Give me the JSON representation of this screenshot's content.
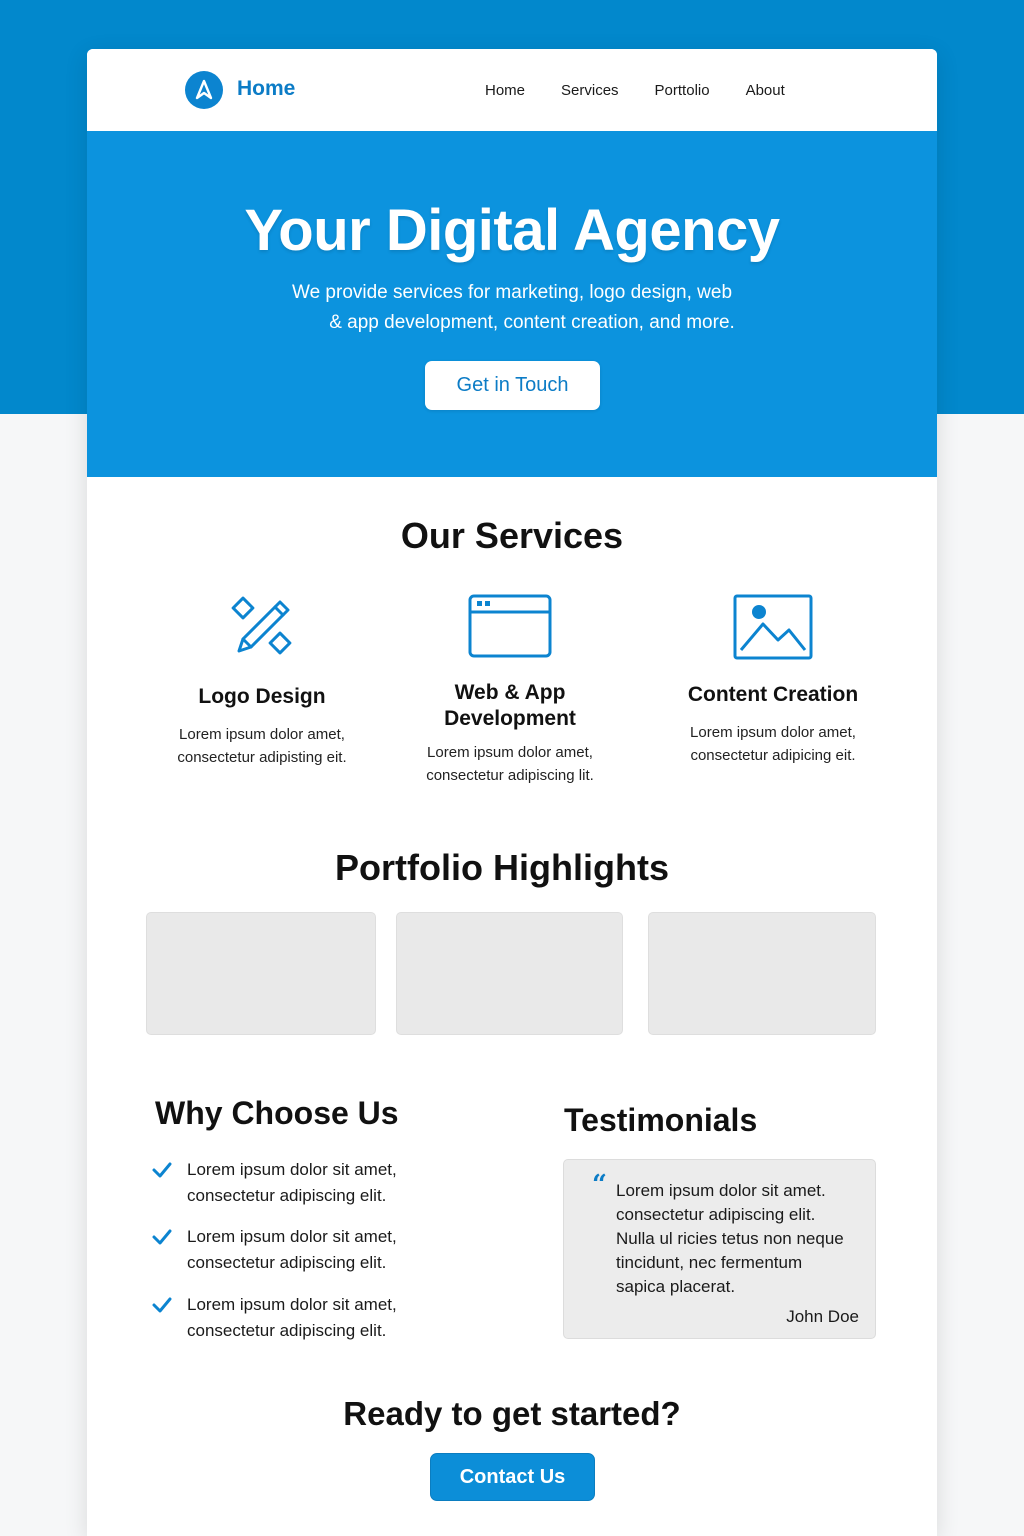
{
  "nav": {
    "brand": "Home",
    "links": [
      "Home",
      "Services",
      "Porttolio",
      "About"
    ]
  },
  "hero": {
    "title": "Your Digital Agency",
    "subtitle_line1": "We provide services for marketing, logo design, web",
    "subtitle_line2": "& app development, content creation, and more.",
    "button": "Get in Touch"
  },
  "services": {
    "title": "Our Services",
    "items": [
      {
        "icon": "pencil-ruler-icon",
        "title": "Logo Design",
        "desc_line1": "Lorem ipsum dolor amet,",
        "desc_line2": "consectetur adipisting eit."
      },
      {
        "icon": "browser-window-icon",
        "title_line1": "Web & App",
        "title_line2": "Development",
        "desc_line1": "Lorem ipsum dolor amet,",
        "desc_line2": "consectetur adipiscing lit."
      },
      {
        "icon": "image-icon",
        "title": "Content Creation",
        "desc_line1": "Lorem ipsum dolor amet,",
        "desc_line2": "consectetur adipicing eit."
      }
    ]
  },
  "portfolio": {
    "title": "Portfolio Highlights"
  },
  "why": {
    "title": "Why Choose Us",
    "items": [
      {
        "line1": "Lorem ipsum dolor sit amet,",
        "line2": "consectetur adipiscing elit."
      },
      {
        "line1": "Lorem ipsum dolor sit amet,",
        "line2": "consectetur adipiscing elit."
      },
      {
        "line1": "Lorem ipsum dolor sit amet,",
        "line2": "consectetur adipiscing elit."
      }
    ]
  },
  "testimonials": {
    "title": "Testimonials",
    "quote_mark": "“",
    "lines": [
      "Lorem ipsum dolor sit amet.",
      "consectetur adipiscing elit.",
      "Nulla ul ricies tetus non neque",
      "tincidunt, nec fermentum",
      "sapica placerat."
    ],
    "author": "John Doe"
  },
  "cta": {
    "title": "Ready to get started?",
    "button": "Contact Us"
  },
  "colors": {
    "primary": "#0c93de",
    "page_top": "#0288cc",
    "brand_text": "#0c7cc6",
    "placeholder": "#e9e9e9"
  }
}
